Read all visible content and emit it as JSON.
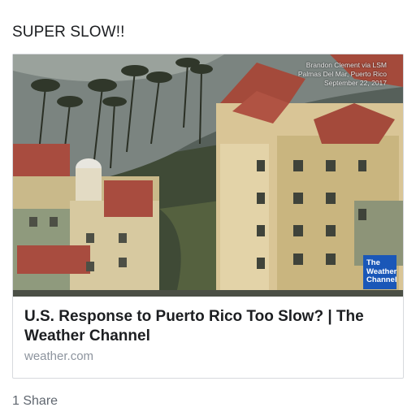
{
  "post": {
    "text": "SUPER SLOW!!"
  },
  "link_card": {
    "image": {
      "credit_lines": [
        "Brandon Clement via LSM",
        "Palmas Del Mar, Puerto Rico",
        "September 22, 2017"
      ],
      "logo_lines": [
        "The",
        "Weather",
        "Channel"
      ]
    },
    "headline": "U.S. Response to Puerto Rico Too Slow? | The Weather Channel",
    "domain": "weather.com"
  },
  "footer": {
    "shares": "1 Share"
  }
}
